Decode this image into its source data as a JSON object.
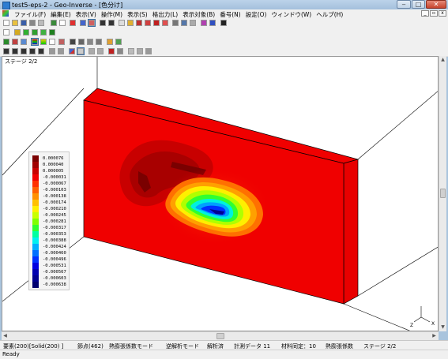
{
  "window": {
    "title": "test5-eps-2 - Geo-Inverse - [色分け]"
  },
  "menubar": {
    "items": [
      "ファイル(F)",
      "編集(E)",
      "表示(V)",
      "操作(M)",
      "表示(S)",
      "格出力(L)",
      "表示対象(B)",
      "番号(N)",
      "設定(O)",
      "ウィンドウ(W)",
      "ヘルプ(H)"
    ]
  },
  "viewport": {
    "stage_label": "ステージ 2/2"
  },
  "legend": {
    "values": [
      "0.000076",
      "0.000040",
      "0.000005",
      "-0.000031",
      "-0.000067",
      "-0.000103",
      "-0.000138",
      "-0.000174",
      "-0.000210",
      "-0.000245",
      "-0.000281",
      "-0.000317",
      "-0.000353",
      "-0.000388",
      "-0.000424",
      "-0.000460",
      "-0.000496",
      "-0.000531",
      "-0.000567",
      "-0.000603",
      "-0.000638"
    ],
    "colors": [
      "#7a0000",
      "#a00000",
      "#c80000",
      "#f00000",
      "#ff3000",
      "#ff6000",
      "#ff9000",
      "#ffc000",
      "#ffef00",
      "#c8ff00",
      "#80ff00",
      "#30ff30",
      "#00ffa0",
      "#00f0f0",
      "#00b0ff",
      "#0070ff",
      "#0030ff",
      "#0000e0",
      "#0000b0",
      "#000090",
      "#000070"
    ]
  },
  "axes": {
    "x": "X",
    "z": "Z"
  },
  "infobar": {
    "fields": [
      "要素(200)[Solid(200) ]",
      "節点(462)",
      "熱膨張係数モード",
      "逆解析モード",
      "解析済",
      "計測データ 11",
      "材料同定：10",
      "熱膨張係数",
      "ステージ 2/2"
    ]
  },
  "status": {
    "text": "Ready"
  }
}
